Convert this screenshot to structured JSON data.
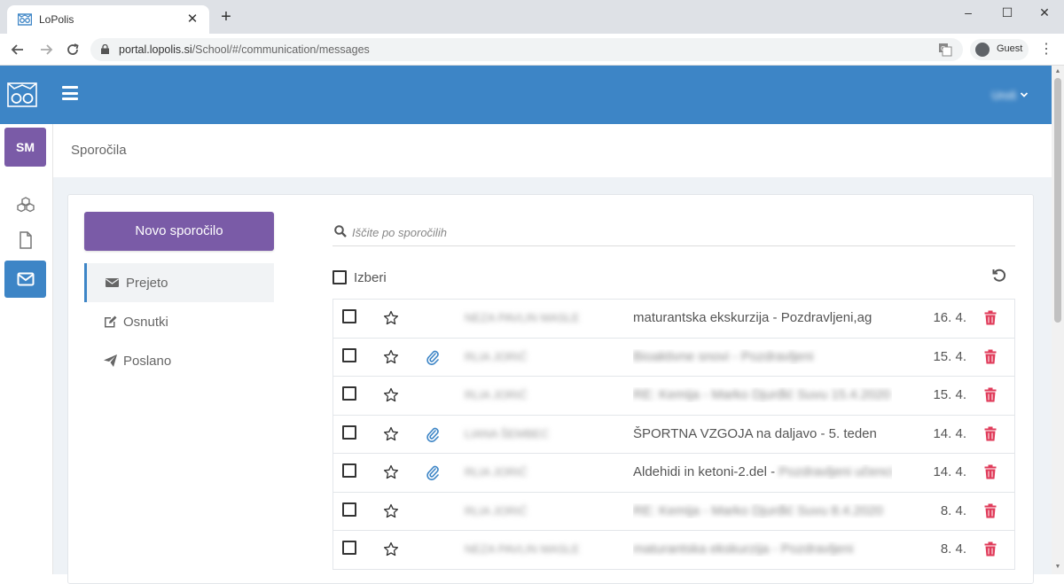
{
  "browser": {
    "tab_title": "LoPolis",
    "tab_close": "✕",
    "new_tab": "+",
    "url_host": "portal.lopolis.si",
    "url_path": "/School/#/communication/messages",
    "profile_label": "Guest",
    "window_controls": [
      "–",
      "☐",
      "✕"
    ]
  },
  "app": {
    "header_color": "#3d85c6",
    "user_name": "Uroš",
    "user_initials": "SM",
    "breadcrumb": "Sporočila"
  },
  "sidebar": {
    "new_message_label": "Novo sporočilo",
    "folders": [
      {
        "label": "Prejeto",
        "icon": "envelope-icon",
        "active": true
      },
      {
        "label": "Osnutki",
        "icon": "edit-icon",
        "active": false
      },
      {
        "label": "Poslano",
        "icon": "send-icon",
        "active": false
      }
    ]
  },
  "search": {
    "placeholder": "Iščite po sporočilih"
  },
  "toolbar": {
    "select_all_label": "Izberi"
  },
  "messages": [
    {
      "sender": "NEZA PAVLIN MASLE",
      "subject": "maturantska ekskurzija - Pozdravljeni,ag",
      "subject_blurred": "",
      "attachment": false,
      "date": "16. 4."
    },
    {
      "sender": "RLIA JORIĆ",
      "subject": "",
      "subject_blurred": "Bioaktivne snovi - Pozdravljeni",
      "attachment": true,
      "date": "15. 4."
    },
    {
      "sender": "RLIA JORIĆ",
      "subject": "",
      "subject_blurred": "RE: Kemija - Marko Djurđić Suvu 15.4.2020",
      "attachment": false,
      "date": "15. 4."
    },
    {
      "sender": "LIANA ŠEMBEC",
      "subject": "ŠPORTNA VZGOJA na daljavo - 5. teden",
      "subject_blurred": "",
      "attachment": true,
      "date": "14. 4."
    },
    {
      "sender": "RLIA JORIĆ",
      "subject": "Aldehidi in ketoni-2.del - ",
      "subject_blurred": "Pozdravljeni učenci",
      "attachment": true,
      "date": "14. 4."
    },
    {
      "sender": "RLIA JORIĆ",
      "subject": "",
      "subject_blurred": "RE: Kemija - Marko Djurđić Suvu 8.4.2020",
      "attachment": false,
      "date": "8. 4."
    },
    {
      "sender": "NEZA PAVLIN MASLE",
      "subject": "",
      "subject_blurred": "maturantska ekskurzija - Pozdravljeni",
      "attachment": false,
      "date": "8. 4."
    }
  ]
}
